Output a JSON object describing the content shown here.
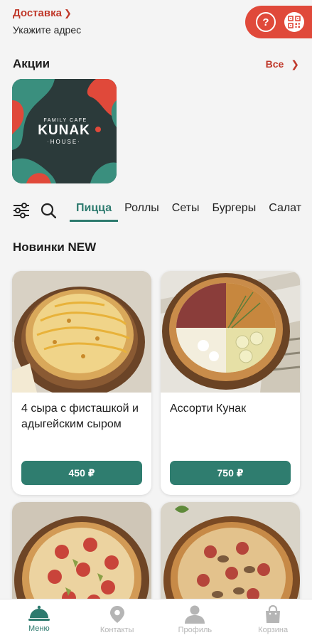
{
  "header": {
    "delivery_label": "Доставка",
    "address_prompt": "Укажите адрес",
    "help_symbol": "?"
  },
  "promos": {
    "title": "Акции",
    "all_label": "Все",
    "banner": {
      "top_text": "FAMILY CAFE",
      "brand": "KUNAK",
      "bottom_text": "·HOUSE·"
    }
  },
  "categories": {
    "tabs": [
      {
        "label": "Пицца",
        "active": true
      },
      {
        "label": "Роллы",
        "active": false
      },
      {
        "label": "Сеты",
        "active": false
      },
      {
        "label": "Бургеры",
        "active": false
      },
      {
        "label": "Салат",
        "active": false
      }
    ]
  },
  "section": {
    "title": "Новинки NEW"
  },
  "products": [
    {
      "name": "4 сыра с фисташкой и адыгейским сыром",
      "price": "450 ₽"
    },
    {
      "name": "Ассорти Кунак",
      "price": "750 ₽"
    }
  ],
  "nav": {
    "items": [
      {
        "label": "Меню",
        "icon": "cloche-icon",
        "active": true
      },
      {
        "label": "Контакты",
        "icon": "location-pin-icon",
        "active": false
      },
      {
        "label": "Профиль",
        "icon": "person-icon",
        "active": false
      },
      {
        "label": "Корзина",
        "icon": "bag-icon",
        "active": false
      }
    ]
  },
  "colors": {
    "accent_red": "#e0493a",
    "brand_green": "#2f7d6f",
    "banner_dark": "#2b3a3a"
  }
}
